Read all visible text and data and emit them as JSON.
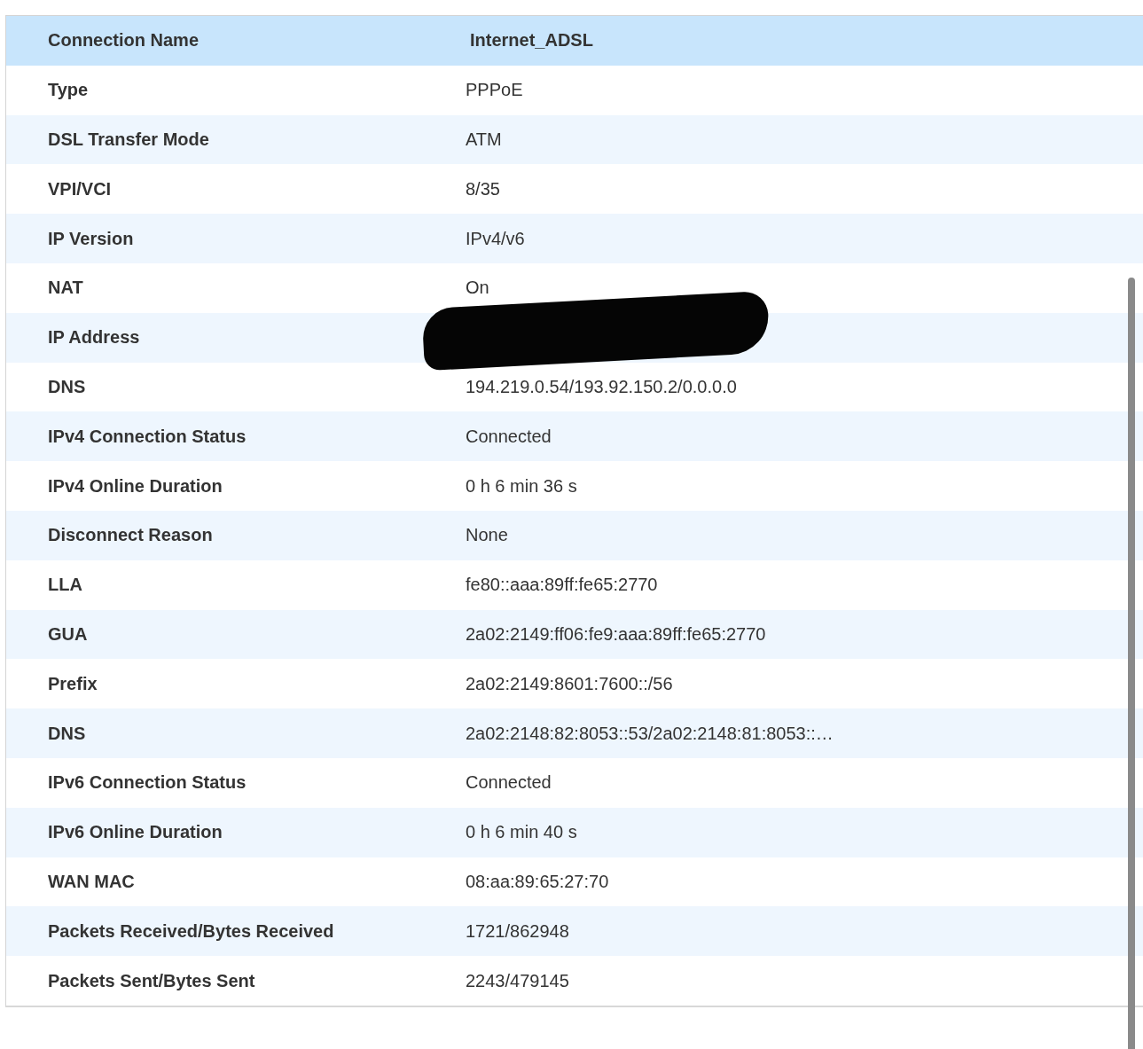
{
  "table": {
    "header": {
      "label": "Connection Name",
      "value": "Internet_ADSL"
    },
    "rows": [
      {
        "label": "Type",
        "value": "PPPoE",
        "redacted": false
      },
      {
        "label": "DSL Transfer Mode",
        "value": "ATM",
        "redacted": false
      },
      {
        "label": "VPI/VCI",
        "value": "8/35",
        "redacted": false
      },
      {
        "label": "IP Version",
        "value": "IPv4/v6",
        "redacted": false
      },
      {
        "label": "NAT",
        "value": "On",
        "redacted": false
      },
      {
        "label": "IP Address",
        "value": "",
        "redacted": true
      },
      {
        "label": "DNS",
        "value": "194.219.0.54/193.92.150.2/0.0.0.0",
        "redacted": false
      },
      {
        "label": "IPv4 Connection Status",
        "value": "Connected",
        "redacted": false
      },
      {
        "label": "IPv4 Online Duration",
        "value": "0 h 6 min 36 s",
        "redacted": false
      },
      {
        "label": "Disconnect Reason",
        "value": "None",
        "redacted": false
      },
      {
        "label": "LLA",
        "value": "fe80::aaa:89ff:fe65:2770",
        "redacted": false
      },
      {
        "label": "GUA",
        "value": "2a02:2149:ff06:fe9:aaa:89ff:fe65:2770",
        "redacted": false
      },
      {
        "label": "Prefix",
        "value": "2a02:2149:8601:7600::/56",
        "redacted": false
      },
      {
        "label": "DNS",
        "value": "2a02:2148:82:8053::53/2a02:2148:81:8053::…",
        "redacted": false
      },
      {
        "label": "IPv6 Connection Status",
        "value": "Connected",
        "redacted": false
      },
      {
        "label": "IPv6 Online Duration",
        "value": "0 h 6 min 40 s",
        "redacted": false
      },
      {
        "label": "WAN MAC",
        "value": "08:aa:89:65:27:70",
        "redacted": false
      },
      {
        "label": "Packets Received/Bytes Received",
        "value": "1721/862948",
        "redacted": false
      },
      {
        "label": "Packets Sent/Bytes Sent",
        "value": "2243/479145",
        "redacted": false
      }
    ]
  }
}
